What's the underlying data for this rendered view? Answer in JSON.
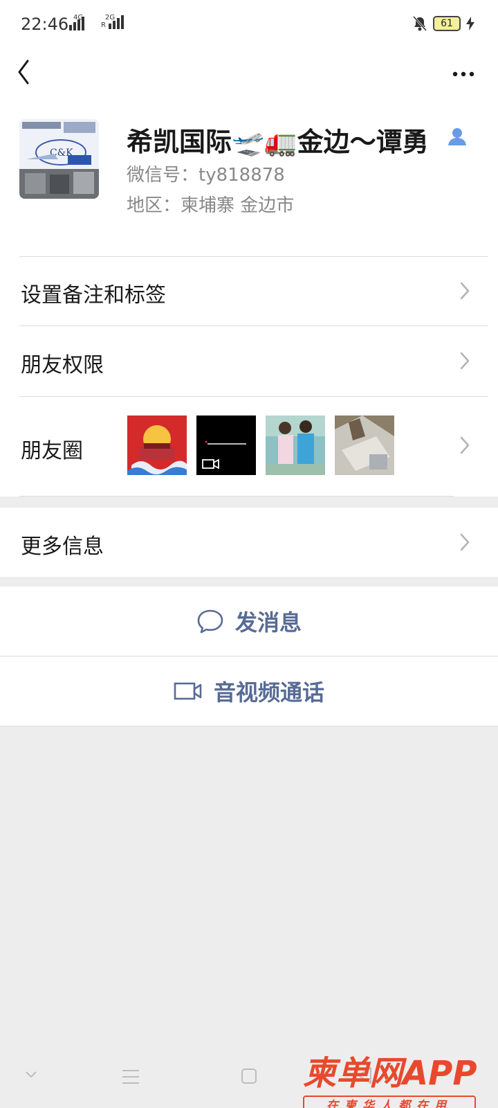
{
  "status_bar": {
    "time": "22:46",
    "net1_label": "4G",
    "net2_label": "2G",
    "net2_sub": "R",
    "battery": "61"
  },
  "profile": {
    "name": "希凯国际🛫🚛金边～谭勇",
    "wechat_id": "微信号：ty818878",
    "region": "地区：柬埔寨  金边市"
  },
  "menu": {
    "remark_label": "设置备注和标签",
    "permissions_label": "朋友权限",
    "moments_label": "朋友圈",
    "more_info_label": "更多信息"
  },
  "actions": {
    "message_label": "发消息",
    "call_label": "音视频通话"
  },
  "watermark": {
    "title": "柬单网APP",
    "subtitle": "在柬华人都在用"
  },
  "colors": {
    "link_blue": "#576b95",
    "background": "#ededed",
    "watermark_red": "#e8492c"
  }
}
